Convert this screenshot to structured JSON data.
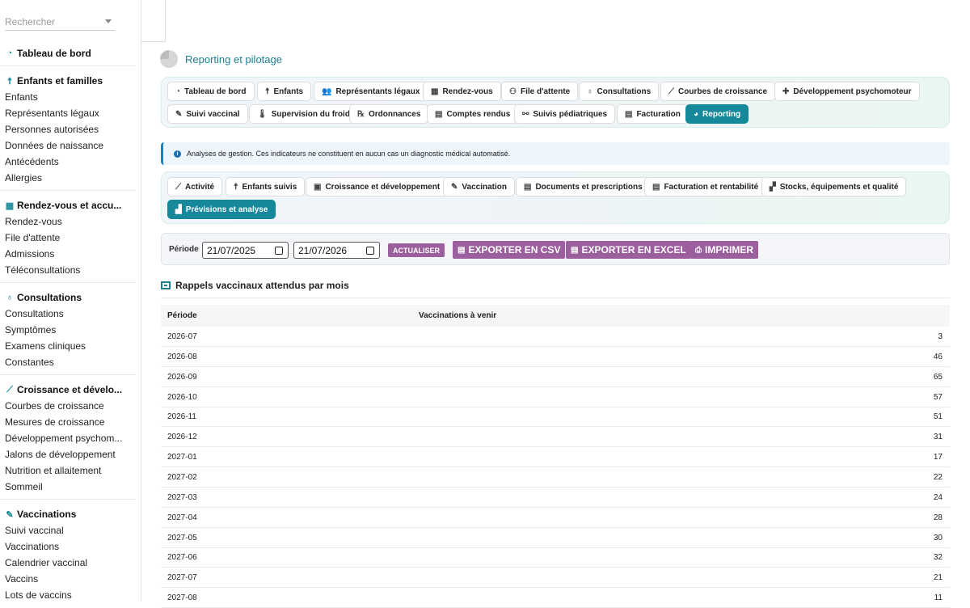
{
  "sidebar": {
    "search_placeholder": "Rechercher",
    "sections": [
      {
        "title": "Tableau de bord",
        "icon": "gauge-icon",
        "items": []
      },
      {
        "title": "Enfants et familles",
        "icon": "child-icon",
        "items": [
          "Enfants",
          "Représentants légaux",
          "Personnes autorisées",
          "Données de naissance",
          "Antécédents",
          "Allergies"
        ]
      },
      {
        "title": "Rendez-vous et accu...",
        "icon": "calendar-icon",
        "items": [
          "Rendez-vous",
          "File d'attente",
          "Admissions",
          "Téléconsultations"
        ]
      },
      {
        "title": "Consultations",
        "icon": "stethoscope-icon",
        "items": [
          "Consultations",
          "Symptômes",
          "Examens cliniques",
          "Constantes"
        ]
      },
      {
        "title": "Croissance et dévelo...",
        "icon": "chart-line-icon",
        "items": [
          "Courbes de croissance",
          "Mesures de croissance",
          "Développement psychom...",
          "Jalons de développement",
          "Nutrition et allaitement",
          "Sommeil"
        ]
      },
      {
        "title": "Vaccinations",
        "icon": "syringe-icon",
        "items": [
          "Suivi vaccinal",
          "Vaccinations",
          "Calendrier vaccinal",
          "Vaccins",
          "Lots de vaccins"
        ]
      }
    ]
  },
  "page": {
    "title": "Reporting et pilotage"
  },
  "module_tabs": [
    {
      "label": "Tableau de bord",
      "icon": "gauge-icon",
      "glyph": "◔"
    },
    {
      "label": "Enfants",
      "icon": "child-icon",
      "glyph": "☨"
    },
    {
      "label": "Représentants légaux",
      "icon": "users-icon",
      "glyph": "👥"
    },
    {
      "label": "Rendez-vous",
      "icon": "calendar-icon",
      "glyph": "▦"
    },
    {
      "label": "File d'attente",
      "icon": "people-icon",
      "glyph": "⚇"
    },
    {
      "label": "Consultations",
      "icon": "stethoscope-icon",
      "glyph": "♁"
    },
    {
      "label": "Courbes de croissance",
      "icon": "chart-line-icon",
      "glyph": "⟋"
    },
    {
      "label": "Développement psychomoteur",
      "icon": "puzzle-icon",
      "glyph": "✚"
    },
    {
      "label": "Suivi vaccinal",
      "icon": "syringe-icon",
      "glyph": "✎"
    },
    {
      "label": "Supervision du froid",
      "icon": "thermometer-icon",
      "glyph": "🌡"
    },
    {
      "label": "Ordonnances",
      "icon": "prescription-icon",
      "glyph": "℞"
    },
    {
      "label": "Comptes rendus",
      "icon": "file-icon",
      "glyph": "▤"
    },
    {
      "label": "Suivis pédiatriques",
      "icon": "sitemap-icon",
      "glyph": "⚯"
    },
    {
      "label": "Facturation",
      "icon": "invoice-icon",
      "glyph": "▤"
    },
    {
      "label": "Reporting",
      "icon": "pie-chart-icon",
      "glyph": "◕",
      "active": true
    }
  ],
  "info": {
    "text": "Analyses de gestion. Ces indicateurs ne constituent en aucun cas un diagnostic médical automatisé.",
    "icon": "info-icon"
  },
  "report_tabs": [
    {
      "label": "Activité",
      "icon": "chart-line-icon",
      "glyph": "⟋"
    },
    {
      "label": "Enfants suivis",
      "icon": "child-icon",
      "glyph": "☨"
    },
    {
      "label": "Croissance et développement",
      "icon": "id-card-icon",
      "glyph": "▣"
    },
    {
      "label": "Vaccination",
      "icon": "syringe-icon",
      "glyph": "✎"
    },
    {
      "label": "Documents et prescriptions",
      "icon": "file-icon",
      "glyph": "▤"
    },
    {
      "label": "Facturation et rentabilité",
      "icon": "invoice-icon",
      "glyph": "▤"
    },
    {
      "label": "Stocks, équipements et qualité",
      "icon": "boxes-icon",
      "glyph": "▞"
    },
    {
      "label": "Prévisions et analyse",
      "icon": "chart-area-icon",
      "glyph": "▟",
      "active": true
    }
  ],
  "filter": {
    "label": "Période",
    "start": "21/07/2025",
    "end": "21/07/2026",
    "refresh": "ACTUALISER",
    "csv": "EXPORTER EN CSV",
    "excel": "EXPORTER EN EXCEL",
    "print": "IMPRIMER"
  },
  "section": {
    "title": "Rappels vaccinaux attendus par mois"
  },
  "table": {
    "columns": [
      "Période",
      "Vaccinations à venir"
    ],
    "rows": [
      [
        "2026-07",
        "3"
      ],
      [
        "2026-08",
        "46"
      ],
      [
        "2026-09",
        "65"
      ],
      [
        "2026-10",
        "57"
      ],
      [
        "2026-11",
        "51"
      ],
      [
        "2026-12",
        "31"
      ],
      [
        "2027-01",
        "17"
      ],
      [
        "2027-02",
        "22"
      ],
      [
        "2027-03",
        "24"
      ],
      [
        "2027-04",
        "28"
      ],
      [
        "2027-05",
        "30"
      ],
      [
        "2027-06",
        "32"
      ],
      [
        "2027-07",
        "21"
      ],
      [
        "2027-08",
        "11"
      ]
    ]
  },
  "colors": {
    "accent": "#15899a",
    "button": "#9c5f9e",
    "info_border": "#1e7fc1"
  }
}
